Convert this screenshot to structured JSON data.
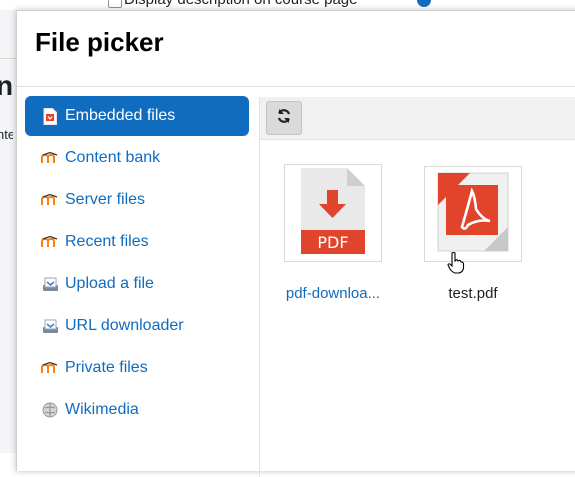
{
  "background_page": {
    "top_text": "Display description on course page",
    "heading": "nt",
    "sub_text": "nte"
  },
  "modal": {
    "title": "File picker"
  },
  "sidebar": {
    "items": [
      {
        "label": "Embedded files",
        "icon": "pdf-file-icon",
        "active": true
      },
      {
        "label": "Content bank",
        "icon": "moodle-icon",
        "active": false
      },
      {
        "label": "Server files",
        "icon": "moodle-icon",
        "active": false
      },
      {
        "label": "Recent files",
        "icon": "moodle-icon",
        "active": false
      },
      {
        "label": "Upload a file",
        "icon": "upload-icon",
        "active": false
      },
      {
        "label": "URL downloader",
        "icon": "url-download-icon",
        "active": false
      },
      {
        "label": "Private files",
        "icon": "moodle-icon",
        "active": false
      },
      {
        "label": "Wikimedia",
        "icon": "wikimedia-icon",
        "active": false
      }
    ]
  },
  "toolbar": {
    "refresh_icon": "refresh-icon"
  },
  "files": [
    {
      "name": "pdf-downloa...",
      "icon": "pdf-download-icon",
      "color": "#0f6cbf"
    },
    {
      "name": "test.pdf",
      "icon": "adobe-pdf-icon",
      "color": "#1d2125"
    }
  ],
  "colors": {
    "accent": "#0f6cbf",
    "pdf_red": "#e0452c"
  }
}
